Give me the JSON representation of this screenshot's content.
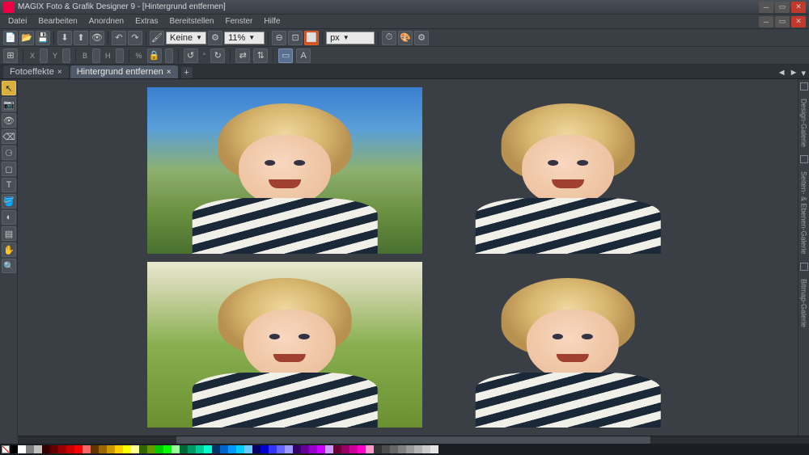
{
  "title": "MAGIX Foto & Grafik Designer 9 - [Hintergrund entfernen]",
  "menu": [
    "Datei",
    "Bearbeiten",
    "Anordnen",
    "Extras",
    "Bereitstellen",
    "Fenster",
    "Hilfe"
  ],
  "toolbar": {
    "combo1": "Keine",
    "zoom": "11%",
    "nudge": "px"
  },
  "prop": {
    "x": "X",
    "y": "Y",
    "w": "B",
    "h": "H",
    "pct": "%",
    "deg": "°"
  },
  "tabs": [
    {
      "label": "Fotoeffekte",
      "active": false
    },
    {
      "label": "Hintergrund entfernen",
      "active": true
    }
  ],
  "right_panels": [
    "Design-Galerie",
    "Seiten- & Ebenen-Galerie",
    "Bitmap-Galerie"
  ],
  "palette": [
    "#000000",
    "#ffffff",
    "#7f7f7f",
    "#c0c0c0",
    "#330000",
    "#660000",
    "#990000",
    "#cc0000",
    "#ff0000",
    "#ff6666",
    "#663300",
    "#996600",
    "#cc9900",
    "#ffcc00",
    "#ffff00",
    "#ffff99",
    "#336600",
    "#669900",
    "#00cc00",
    "#00ff00",
    "#99ff99",
    "#006633",
    "#009966",
    "#00cc99",
    "#00ffcc",
    "#003366",
    "#0066cc",
    "#0099ff",
    "#00ccff",
    "#66ccff",
    "#000066",
    "#0000cc",
    "#3333ff",
    "#6666ff",
    "#9999ff",
    "#330066",
    "#660099",
    "#9900cc",
    "#cc00ff",
    "#cc99ff",
    "#660033",
    "#990066",
    "#cc0099",
    "#ff00cc",
    "#ff99cc",
    "#333333",
    "#4d4d4d",
    "#666666",
    "#808080",
    "#999999",
    "#b3b3b3",
    "#cccccc",
    "#e6e6e6"
  ]
}
